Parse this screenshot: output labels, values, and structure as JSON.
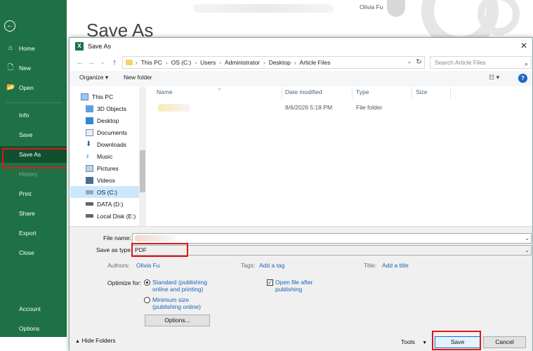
{
  "window": {
    "title": "Save As"
  },
  "backstage": {
    "page_title": "Save As",
    "user_name": "Olivia Fu",
    "items": [
      {
        "label": "Home",
        "icon": "home-icon"
      },
      {
        "label": "New",
        "icon": "new-icon"
      },
      {
        "label": "Open",
        "icon": "open-folder-icon"
      },
      {
        "label": "Info"
      },
      {
        "label": "Save"
      },
      {
        "label": "Save As",
        "active": true
      },
      {
        "label": "History",
        "disabled": true
      },
      {
        "label": "Print"
      },
      {
        "label": "Share"
      },
      {
        "label": "Export"
      },
      {
        "label": "Close"
      },
      {
        "label": "Account"
      },
      {
        "label": "Options"
      }
    ]
  },
  "dialog": {
    "title": "Save As",
    "breadcrumb": [
      "This PC",
      "OS (C:)",
      "Users",
      "Administrator",
      "Desktop",
      "Article Files"
    ],
    "search_placeholder": "Search Article Files",
    "toolbar": {
      "organize": "Organize ▾",
      "new_folder": "New folder",
      "help": "?"
    },
    "nav_items": [
      {
        "label": "This PC",
        "icon": "computer-icon"
      },
      {
        "label": "3D Objects",
        "icon": "3d-objects-icon"
      },
      {
        "label": "Desktop",
        "icon": "desktop-icon"
      },
      {
        "label": "Documents",
        "icon": "documents-icon"
      },
      {
        "label": "Downloads",
        "icon": "downloads-icon"
      },
      {
        "label": "Music",
        "icon": "music-icon"
      },
      {
        "label": "Pictures",
        "icon": "pictures-icon"
      },
      {
        "label": "Videos",
        "icon": "videos-icon"
      },
      {
        "label": "OS (C:)",
        "icon": "drive-icon",
        "selected": true
      },
      {
        "label": "DATA (D:)",
        "icon": "drive-icon"
      },
      {
        "label": "Local Disk (E:)",
        "icon": "drive-icon"
      }
    ],
    "columns": {
      "name": "Name",
      "date": "Date modified",
      "type": "Type",
      "size": "Size"
    },
    "files": [
      {
        "date": "8/6/2026 5:18 PM",
        "type": "File folder"
      }
    ],
    "form": {
      "file_name_label": "File name:",
      "save_type_label": "Save as type:",
      "save_type_value": "PDF",
      "authors_label": "Authors:",
      "authors_value": "Olivia Fu",
      "tags_label": "Tags:",
      "tags_value": "Add a tag",
      "title_label": "Title:",
      "title_value": "Add a title",
      "optimize_label": "Optimize for:",
      "opt_standard": "Standard (publishing online and printing)",
      "opt_minimum": "Minimum size (publishing online)",
      "open_after": "Open file after publishing",
      "options_button": "Options...",
      "hide_folders": "Hide Folders",
      "tools": "Tools",
      "save_button": "Save",
      "cancel_button": "Cancel"
    }
  },
  "colors": {
    "excel_green": "#1e7145",
    "highlight_red": "#e0171b",
    "link_blue": "#1a62b8"
  }
}
